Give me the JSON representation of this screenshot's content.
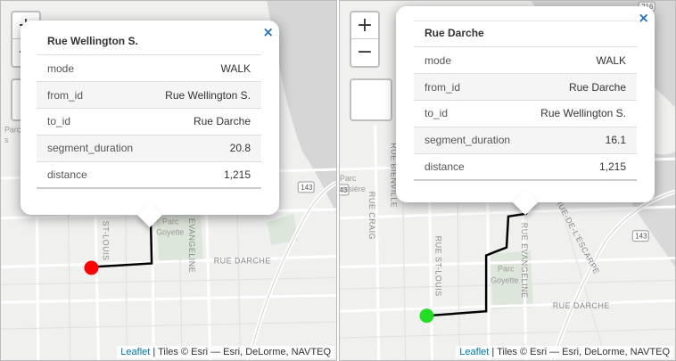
{
  "maps": [
    {
      "zoom_in": "+",
      "zoom_out": "−",
      "popup": {
        "title": "Rue Wellington S.",
        "close": "×",
        "rows": [
          {
            "key": "mode",
            "value": "WALK"
          },
          {
            "key": "from_id",
            "value": "Rue Wellington S."
          },
          {
            "key": "to_id",
            "value": "Rue Darche"
          },
          {
            "key": "segment_duration",
            "value": "20.8"
          },
          {
            "key": "distance",
            "value": "1,215"
          }
        ]
      },
      "labels": {
        "darche": "RUE DARCHE",
        "stlouis": "ST-LOUIS",
        "evangeline": "EVANGELINE",
        "parc": "Parc",
        "goyette": "Goyette",
        "parc_left": "Parc",
        "partial_s": "s",
        "route": "143"
      },
      "marker_color": "#ff0000",
      "attribution": {
        "leaflet": "Leaflet",
        "rest": " | Tiles © Esri — Esri, DeLorme, NAVTEQ"
      }
    },
    {
      "zoom_in": "+",
      "zoom_out": "−",
      "popup": {
        "title": "Rue Darche",
        "close": "×",
        "rows": [
          {
            "key": "mode",
            "value": "WALK"
          },
          {
            "key": "from_id",
            "value": "Rue Darche"
          },
          {
            "key": "to_id",
            "value": "Rue Wellington S."
          },
          {
            "key": "segment_duration",
            "value": "16.1"
          },
          {
            "key": "distance",
            "value": "1,215"
          }
        ]
      },
      "labels": {
        "darche": "RUE DARCHE",
        "stlouis": "RUE ST-LOUIS",
        "evangeline": "RUE EVANGELINE",
        "escarpe": "RUE-DE-L'ESCARPE",
        "craig": "RUE CRAIG",
        "bienville": "RUE BIENVILLE",
        "parc": "Parc",
        "goyette": "Goyette",
        "parc_left": "Parc",
        "ussiere": "ussière",
        "route1": "143",
        "route2": "143",
        "top_num": "216"
      },
      "marker_color": "#22dd22",
      "attribution": {
        "leaflet": "Leaflet",
        "rest": " | Tiles © Esri — Esri, DeLorme, NAVTEQ"
      }
    }
  ]
}
